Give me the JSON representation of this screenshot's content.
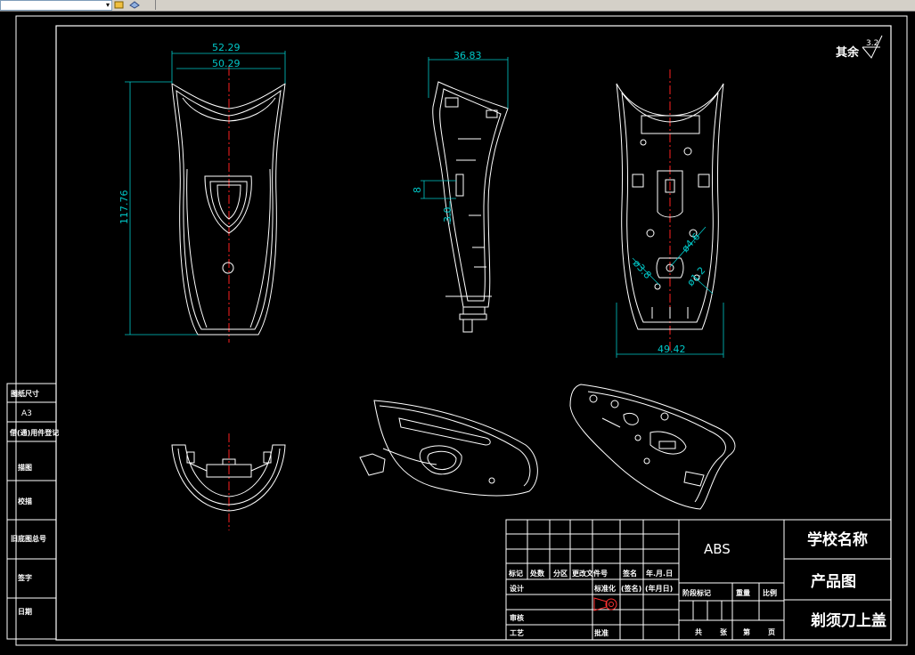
{
  "toolbar": {
    "combo_value": "",
    "combo_arrow": "▾",
    "icons": [
      "layer-icon",
      "layers-stack-icon"
    ]
  },
  "roughness": {
    "label": "其余",
    "value": "3.2"
  },
  "front_view": {
    "width_outer": "52.29",
    "width_inner": "50.29",
    "height": "117.76"
  },
  "side_view": {
    "depth": "36.83",
    "slot": "8",
    "slot2": "3.0"
  },
  "back_view": {
    "width": "49.42",
    "hole_a": "ø4.6",
    "hole_b": "ø3.8",
    "hole_c": "ø1.2"
  },
  "side_strip": {
    "cells": [
      {
        "key": "tuzhi",
        "label": "图纸尺寸"
      },
      {
        "key": "a3",
        "label": "A3"
      },
      {
        "key": "jiegou",
        "label": "借(通)用件登记"
      },
      {
        "key": "miaotu",
        "label": "描图"
      },
      {
        "key": "jiaodui",
        "label": "校描"
      },
      {
        "key": "dipian",
        "label": "旧底图总号"
      },
      {
        "key": "qianzi",
        "label": "签字"
      },
      {
        "key": "riqi",
        "label": "日期"
      }
    ]
  },
  "title_block": {
    "material": "ABS",
    "school": "学校名称",
    "drawing_type": "产品图",
    "part_name": "剃须刀上盖",
    "revision_headers": [
      "标记",
      "处数",
      "分区",
      "更改文件号",
      "签名",
      "年.月.日"
    ],
    "row_design": "设计",
    "row_standard": "标准化",
    "row_sign": "(签名)",
    "row_date": "(年月日)",
    "row_review": "审核",
    "row_process": "工艺",
    "row_approve": "批准",
    "stage_headers": [
      "阶段标记",
      "重量",
      "比例"
    ],
    "sheet_footer": [
      "共",
      "张",
      "第",
      "页"
    ]
  }
}
